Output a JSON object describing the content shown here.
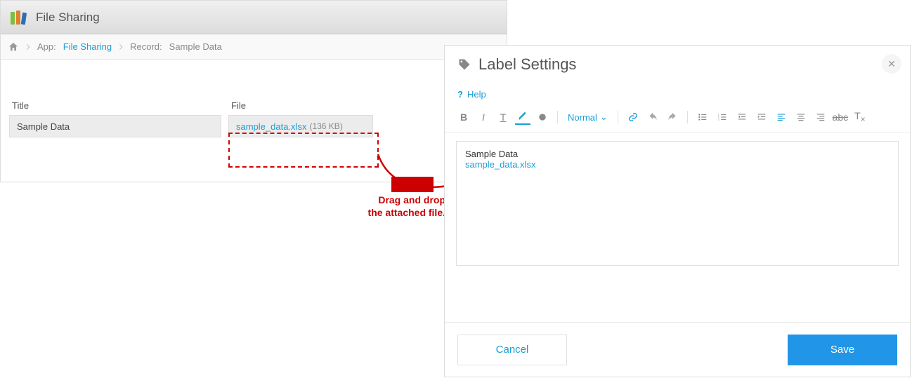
{
  "app": {
    "title": "File Sharing",
    "breadcrumb": {
      "app_prefix": "App:",
      "app_link": "File Sharing",
      "record_prefix": "Record:",
      "record_name": "Sample Data"
    },
    "form": {
      "title_label": "Title",
      "title_value": "Sample Data",
      "file_label": "File",
      "file_name": "sample_data.xlsx",
      "file_size": "(136 KB)"
    }
  },
  "annotation": {
    "caption_line1": "Drag and drop",
    "caption_line2": "the attached file."
  },
  "dialog": {
    "title": "Label Settings",
    "help": "Help",
    "toolbar": {
      "fontsize": "Normal"
    },
    "editor": {
      "line1": "Sample Data",
      "line2": "sample_data.xlsx"
    },
    "cancel": "Cancel",
    "save": "Save"
  },
  "colors": {
    "accent": "#1a9ed6",
    "danger": "#cc0000",
    "primary_button": "#2196e8"
  }
}
